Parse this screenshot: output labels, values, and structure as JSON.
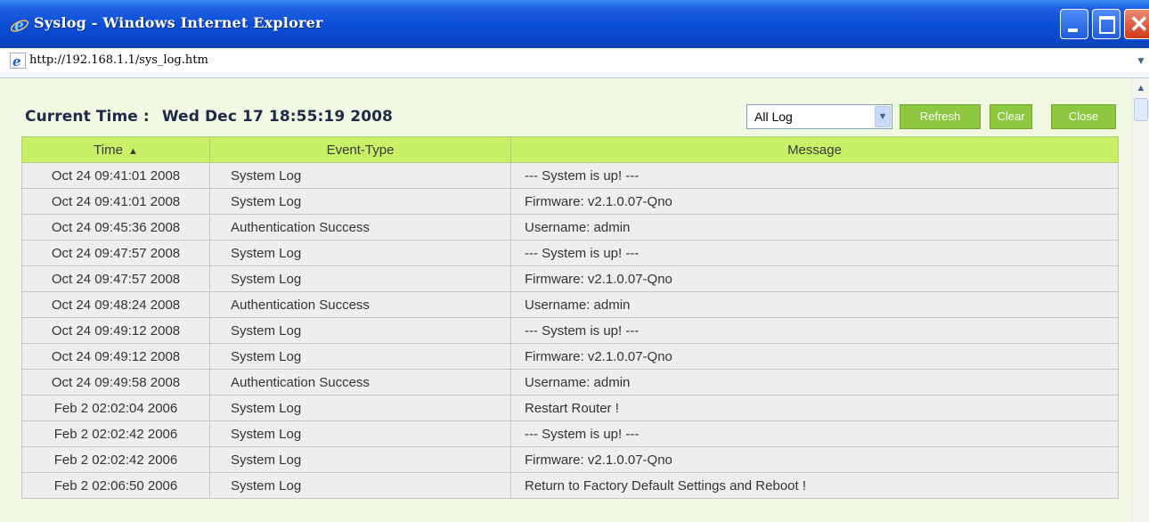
{
  "window": {
    "title": "Syslog - Windows Internet Explorer",
    "close_glyph": "✕"
  },
  "address": {
    "url": "http://192.168.1.1/sys_log.htm"
  },
  "header": {
    "current_time_label": "Current Time :",
    "current_time_value": "Wed Dec 17 18:55:19 2008",
    "filter_selected": "All Log",
    "refresh_label": "Refresh",
    "clear_label": "Clear",
    "close_label": "Close"
  },
  "table": {
    "columns": [
      "Time",
      "Event-Type",
      "Message"
    ],
    "sort_indicator": "▲",
    "rows": [
      [
        "Oct 24 09:41:01 2008",
        "System Log",
        "--- System is up! ---"
      ],
      [
        "Oct 24 09:41:01 2008",
        "System Log",
        "Firmware: v2.1.0.07-Qno"
      ],
      [
        "Oct 24 09:45:36 2008",
        "Authentication Success",
        "Username: admin"
      ],
      [
        "Oct 24 09:47:57 2008",
        "System Log",
        "--- System is up! ---"
      ],
      [
        "Oct 24 09:47:57 2008",
        "System Log",
        "Firmware: v2.1.0.07-Qno"
      ],
      [
        "Oct 24 09:48:24 2008",
        "Authentication Success",
        "Username: admin"
      ],
      [
        "Oct 24 09:49:12 2008",
        "System Log",
        "--- System is up! ---"
      ],
      [
        "Oct 24 09:49:12 2008",
        "System Log",
        "Firmware: v2.1.0.07-Qno"
      ],
      [
        "Oct 24 09:49:58 2008",
        "Authentication Success",
        "Username: admin"
      ],
      [
        "Feb 2 02:02:04 2006",
        "System Log",
        "Restart Router !"
      ],
      [
        "Feb 2 02:02:42 2006",
        "System Log",
        "--- System is up! ---"
      ],
      [
        "Feb 2 02:02:42 2006",
        "System Log",
        "Firmware: v2.1.0.07-Qno"
      ],
      [
        "Feb 2 02:06:50 2006",
        "System Log",
        "Return to Factory Default Settings and Reboot !"
      ]
    ]
  },
  "colors": {
    "page_background": "#f1f9e3",
    "header_green": "#c8f066",
    "button_green": "#8dc63f",
    "titlebar_blue": "#0b4cd6"
  }
}
